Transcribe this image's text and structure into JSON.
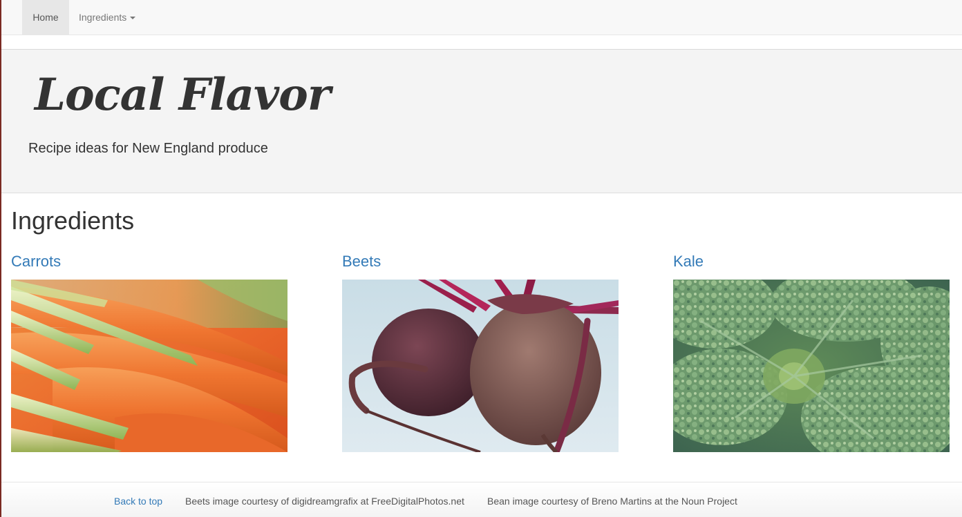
{
  "navbar": {
    "items": [
      {
        "label": "Home",
        "active": true
      },
      {
        "label": "Ingredients",
        "has_dropdown": true
      }
    ]
  },
  "header": {
    "logo_text": "Local Flavor",
    "tagline": "Recipe ideas for New England produce"
  },
  "main": {
    "title": "Ingredients",
    "cards": [
      {
        "label": "Carrots",
        "image": "carrots-photo"
      },
      {
        "label": "Beets",
        "image": "beets-photo"
      },
      {
        "label": "Kale",
        "image": "kale-photo"
      }
    ]
  },
  "footer": {
    "back_to_top": "Back to top",
    "credit_beets": "Beets image courtesy of digidreamgrafix at FreeDigitalPhotos.net",
    "credit_bean": "Bean image courtesy of Breno Martins at the Noun Project"
  },
  "colors": {
    "link": "#337ab7",
    "navbar_bg": "#f8f8f8",
    "jumbotron_bg": "#f4f4f4"
  }
}
